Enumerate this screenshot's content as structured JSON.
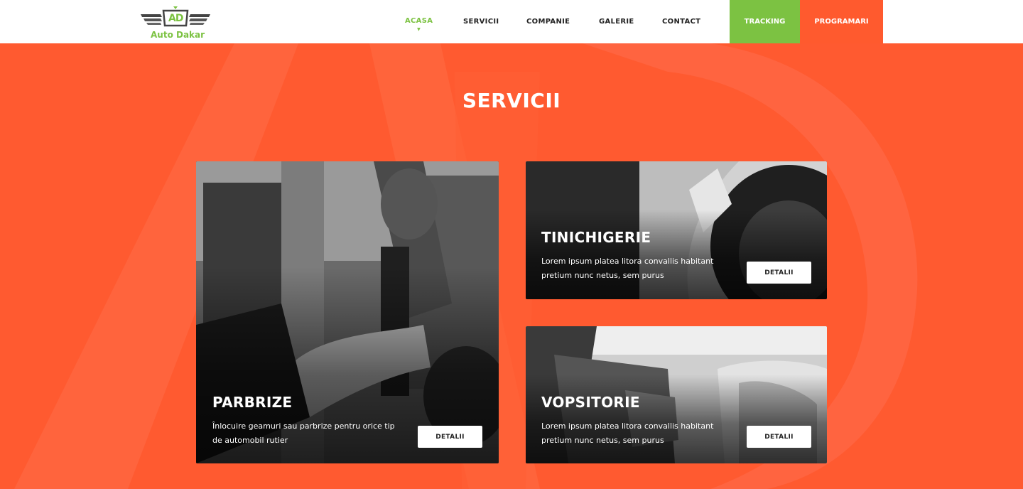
{
  "brand": {
    "name": "Auto Dakar",
    "monogram": "AD",
    "accent": "#7cc242",
    "primary": "#ff5a30"
  },
  "nav": {
    "items": [
      {
        "label": "ACASA",
        "active": true
      },
      {
        "label": "SERVICII",
        "active": false
      },
      {
        "label": "COMPANIE",
        "active": false
      },
      {
        "label": "GALERIE",
        "active": false
      },
      {
        "label": "CONTACT",
        "active": false
      }
    ],
    "tracking_label": "TRACKING",
    "programari_label": "PROGRAMARI"
  },
  "section": {
    "title": "SERVICII"
  },
  "cards": [
    {
      "title": "PARBRIZE",
      "description_line1": "Înlocuire geamuri sau parbrize pentru orice tip",
      "description_line2": "de automobil rutier",
      "button_label": "DETALII",
      "image": "windshield-suction-tool-photo"
    },
    {
      "title": "TINICHIGERIE",
      "description_line1": "Lorem ipsum platea litora convallis habitant",
      "description_line2": "pretium nunc netus, sem purus",
      "button_label": "DETALII",
      "image": "sanding-car-fender-photo"
    },
    {
      "title": "VOPSITORIE",
      "description_line1": "Lorem ipsum platea litora convallis habitant",
      "description_line2": "pretium nunc netus, sem purus",
      "button_label": "DETALII",
      "image": "paint-booth-car-photo"
    }
  ]
}
